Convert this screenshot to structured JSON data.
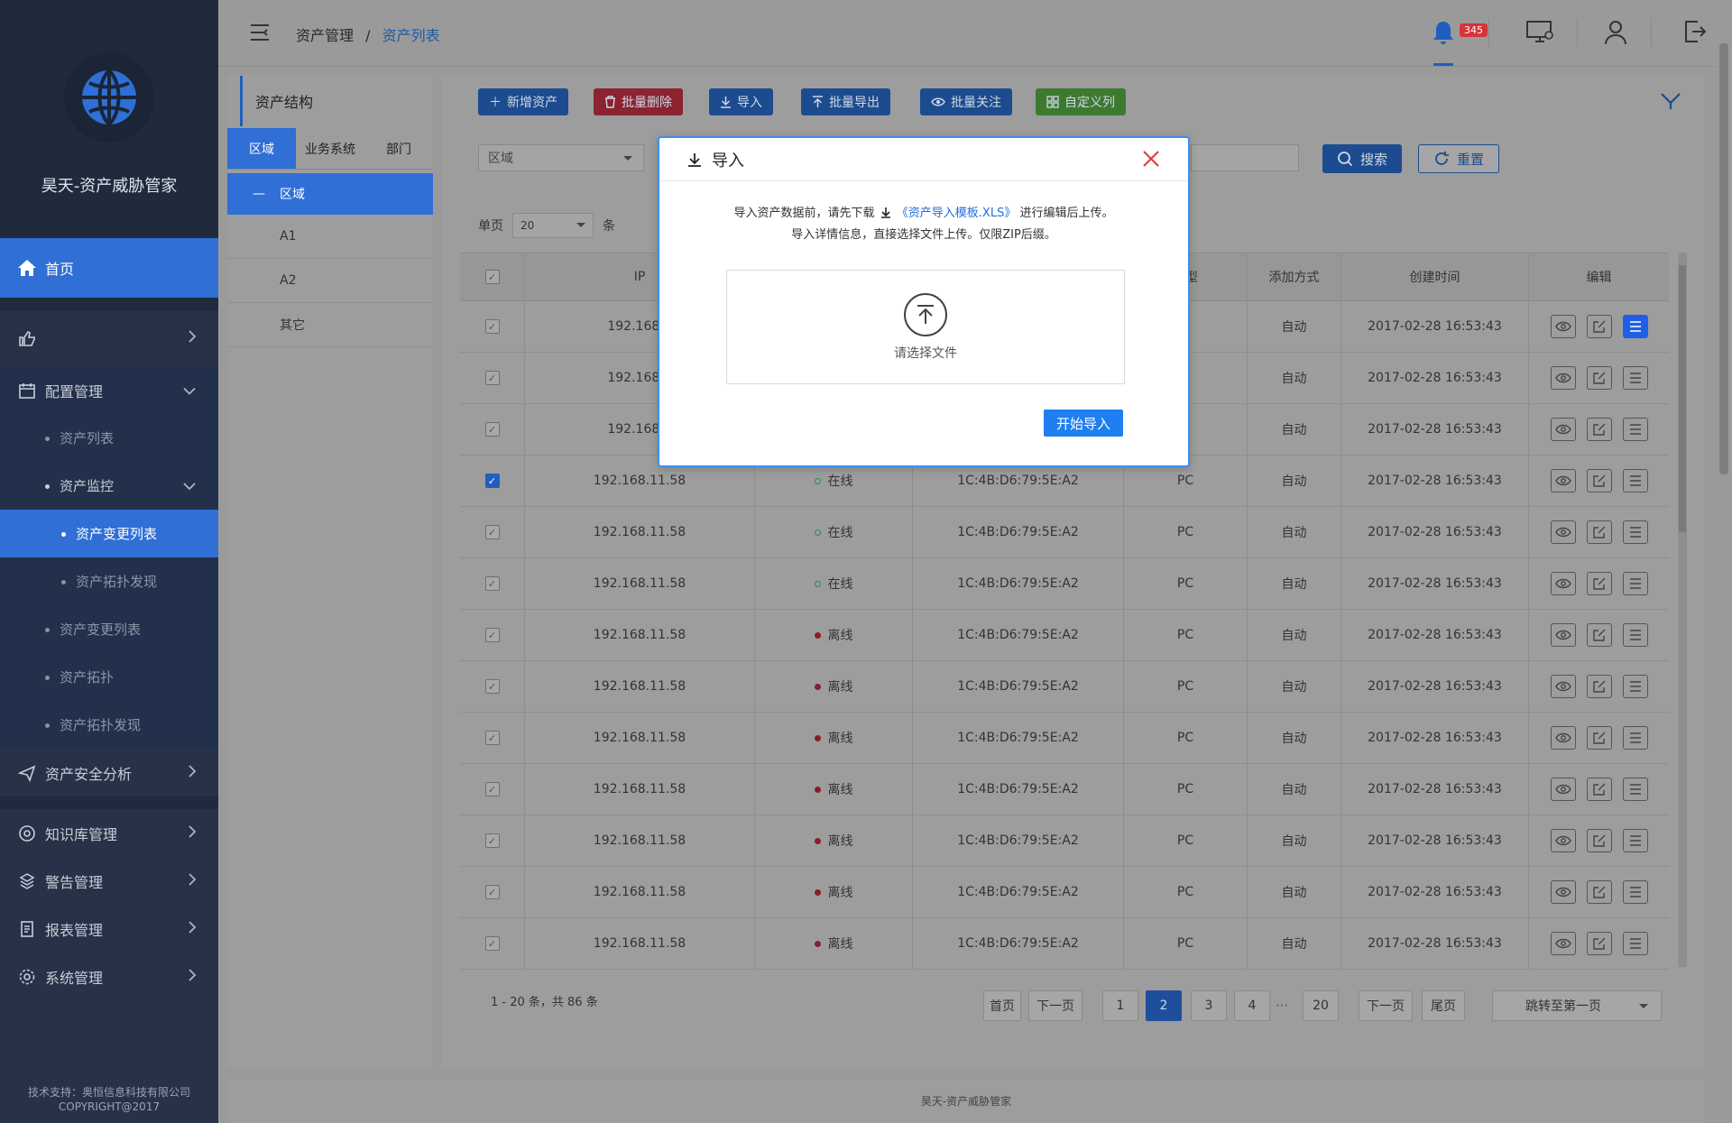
{
  "app": {
    "title": "昊天-资产威胁管家",
    "support_line1": "技术支持：奥恒信息科技有限公司",
    "support_line2": "COPYRIGHT@2017",
    "footer": "昊天-资产威胁管家"
  },
  "sidebar": {
    "home": "首页",
    "config": "配置管理",
    "asset_list": "资产列表",
    "asset_monitor": "资产监控",
    "asset_change_list": "资产变更列表",
    "asset_topo_discover": "资产拓扑发现",
    "asset_change_list2": "资产变更列表",
    "asset_topo": "资产拓扑",
    "asset_topo_discover2": "资产拓扑发现",
    "security_analysis": "资产安全分析",
    "knowledge": "知识库管理",
    "alarm": "警告管理",
    "report": "报表管理",
    "system": "系统管理"
  },
  "header": {
    "crumb_root": "资产管理",
    "crumb_sep": "/",
    "crumb_current": "资产列表",
    "badge": "345"
  },
  "left_panel": {
    "title": "资产结构",
    "tabs": [
      "区域",
      "业务系统",
      "部门"
    ],
    "root": "区域",
    "nodes": [
      "A1",
      "A2",
      "其它"
    ]
  },
  "toolbar": {
    "add": "新增资产",
    "batch_delete": "批量删除",
    "import": "导入",
    "batch_export": "批量导出",
    "batch_follow": "批量关注",
    "custom_cols": "自定义列"
  },
  "filter": {
    "region_placeholder": "区域",
    "search": "搜索",
    "reset": "重置"
  },
  "page_size": {
    "prefix": "单页",
    "value": "20",
    "suffix": "条"
  },
  "table": {
    "headers": [
      "IP",
      "",
      "",
      "类型",
      "添加方式",
      "创建时间",
      "编辑"
    ],
    "rows": [
      {
        "ip": "192.168.1",
        "status": "",
        "mac": "",
        "type": "",
        "add": "自动",
        "time": "2017-02-28 16:53:43",
        "checked": false,
        "state": "none"
      },
      {
        "ip": "192.168.1",
        "status": "",
        "mac": "",
        "type": "",
        "add": "自动",
        "time": "2017-02-28 16:53:43",
        "checked": false,
        "state": "none"
      },
      {
        "ip": "192.168.1",
        "status": "",
        "mac": "",
        "type": "",
        "add": "自动",
        "time": "2017-02-28 16:53:43",
        "checked": false,
        "state": "none"
      },
      {
        "ip": "192.168.11.58",
        "status": "在线",
        "mac": "1C:4B:D6:79:5E:A2",
        "type": "PC",
        "add": "自动",
        "time": "2017-02-28 16:53:43",
        "checked": true,
        "state": "on"
      },
      {
        "ip": "192.168.11.58",
        "status": "在线",
        "mac": "1C:4B:D6:79:5E:A2",
        "type": "PC",
        "add": "自动",
        "time": "2017-02-28 16:53:43",
        "checked": false,
        "state": "on"
      },
      {
        "ip": "192.168.11.58",
        "status": "在线",
        "mac": "1C:4B:D6:79:5E:A2",
        "type": "PC",
        "add": "自动",
        "time": "2017-02-28 16:53:43",
        "checked": false,
        "state": "on"
      },
      {
        "ip": "192.168.11.58",
        "status": "离线",
        "mac": "1C:4B:D6:79:5E:A2",
        "type": "PC",
        "add": "自动",
        "time": "2017-02-28 16:53:43",
        "checked": false,
        "state": "off"
      },
      {
        "ip": "192.168.11.58",
        "status": "离线",
        "mac": "1C:4B:D6:79:5E:A2",
        "type": "PC",
        "add": "自动",
        "time": "2017-02-28 16:53:43",
        "checked": false,
        "state": "off"
      },
      {
        "ip": "192.168.11.58",
        "status": "离线",
        "mac": "1C:4B:D6:79:5E:A2",
        "type": "PC",
        "add": "自动",
        "time": "2017-02-28 16:53:43",
        "checked": false,
        "state": "off"
      },
      {
        "ip": "192.168.11.58",
        "status": "离线",
        "mac": "1C:4B:D6:79:5E:A2",
        "type": "PC",
        "add": "自动",
        "time": "2017-02-28 16:53:43",
        "checked": false,
        "state": "off"
      },
      {
        "ip": "192.168.11.58",
        "status": "离线",
        "mac": "1C:4B:D6:79:5E:A2",
        "type": "PC",
        "add": "自动",
        "time": "2017-02-28 16:53:43",
        "checked": false,
        "state": "off"
      },
      {
        "ip": "192.168.11.58",
        "status": "离线",
        "mac": "1C:4B:D6:79:5E:A2",
        "type": "PC",
        "add": "自动",
        "time": "2017-02-28 16:53:43",
        "checked": false,
        "state": "off"
      },
      {
        "ip": "192.168.11.58",
        "status": "离线",
        "mac": "1C:4B:D6:79:5E:A2",
        "type": "PC",
        "add": "自动",
        "time": "2017-02-28 16:53:43",
        "checked": false,
        "state": "off"
      }
    ]
  },
  "pagination": {
    "info": "1 - 20 条，共 86 条",
    "first": "首页",
    "prev": "下一页",
    "pages": [
      "1",
      "2",
      "3",
      "4",
      "20"
    ],
    "ellipsis": "···",
    "next": "下一页",
    "last": "尾页",
    "current": "2",
    "jump": "跳转至第一页"
  },
  "modal": {
    "title": "导入",
    "line1_a": "导入资产数据前，请先下载",
    "line1_link": "《资产导入模板.XLS》",
    "line1_b": "进行编辑后上传。",
    "line2": "导入详情信息，直接选择文件上传。仅限ZIP后缀。",
    "choose_file": "请选择文件",
    "start": "开始导入"
  },
  "colors": {
    "accent": "#1f7ff0",
    "sidebar": "#273248",
    "close": "#e0303e",
    "offline": "#8c1c2b",
    "online": "#2a8a4a"
  }
}
